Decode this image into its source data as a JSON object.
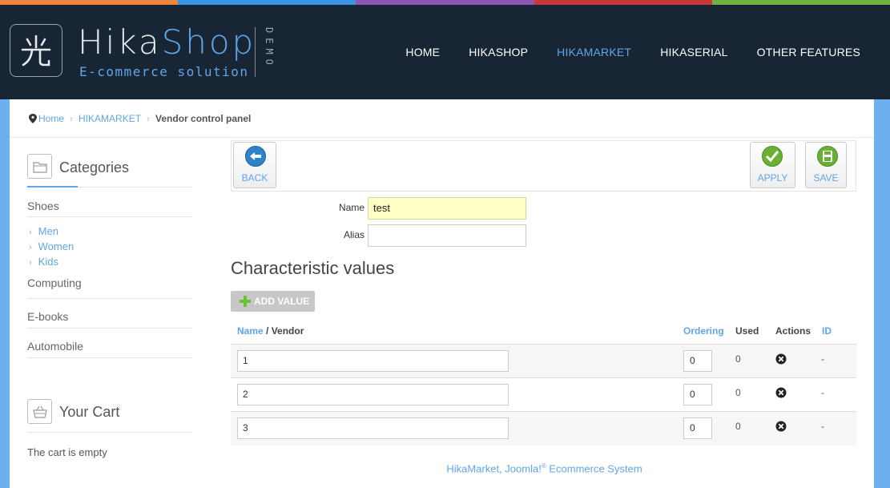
{
  "strip_colors": [
    "#f0863d",
    "#3b95e0",
    "#8c57b3",
    "#c8383b",
    "#6fb443"
  ],
  "brand": {
    "name_part1": "Hika",
    "name_part2": "Shop",
    "tagline": "E-commerce solution",
    "demo": "DEMO",
    "logo_icon": "kanji-hikari-logo"
  },
  "nav": [
    {
      "label": "HOME",
      "active": false
    },
    {
      "label": "HIKASHOP",
      "active": false
    },
    {
      "label": "HIKAMARKET",
      "active": true
    },
    {
      "label": "HIKASERIAL",
      "active": false
    },
    {
      "label": "OTHER FEATURES",
      "active": false
    }
  ],
  "breadcrumb": {
    "home": "Home",
    "parent": "HIKAMARKET",
    "current": "Vendor control panel"
  },
  "sidebar": {
    "categories_title": "Categories",
    "categories": [
      {
        "label": "Shoes",
        "children": [
          "Men",
          "Women",
          "Kids"
        ]
      },
      {
        "label": "Computing"
      },
      {
        "label": "E-books"
      },
      {
        "label": "Automobile"
      }
    ],
    "cart_title": "Your Cart",
    "cart_empty": "The cart is empty"
  },
  "toolbar": {
    "back": "BACK",
    "apply": "APPLY",
    "save": "SAVE"
  },
  "form": {
    "name_label": "Name",
    "name_value": "test",
    "alias_label": "Alias",
    "alias_value": ""
  },
  "section_title": "Characteristic values",
  "add_value": "ADD VALUE",
  "table": {
    "headers": {
      "name": "Name",
      "vendor": " / Vendor",
      "ordering": "Ordering",
      "used": "Used",
      "actions": "Actions",
      "id": "ID"
    },
    "rows": [
      {
        "value": "1",
        "ordering": "0",
        "used": "0",
        "id": "-"
      },
      {
        "value": "2",
        "ordering": "0",
        "used": "0",
        "id": "-"
      },
      {
        "value": "3",
        "ordering": "0",
        "used": "0",
        "id": "-"
      }
    ]
  },
  "footer": {
    "prefix": "HikaMarket, Joomla!",
    "reg": "®",
    "suffix": " Ecommerce System"
  }
}
